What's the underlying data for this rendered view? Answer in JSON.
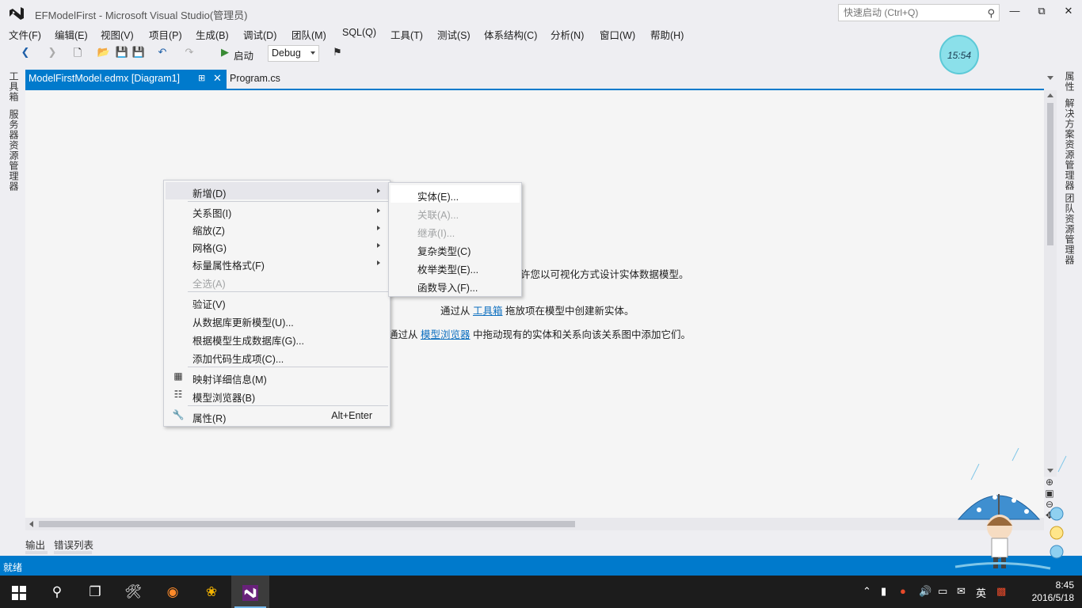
{
  "window": {
    "title": "EFModelFirst - Microsoft Visual Studio(管理员)",
    "quick_launch_placeholder": "快速启动 (Ctrl+Q)"
  },
  "menubar": [
    "文件(F)",
    "编辑(E)",
    "视图(V)",
    "项目(P)",
    "生成(B)",
    "调试(D)",
    "团队(M)",
    "SQL(Q)",
    "工具(T)",
    "测试(S)",
    "体系结构(C)",
    "分析(N)",
    "窗口(W)",
    "帮助(H)"
  ],
  "toolbar": {
    "start_label": "启动",
    "configuration": "Debug",
    "timer": "15:54"
  },
  "left_strip": [
    "工具箱",
    "服务器资源管理器"
  ],
  "right_strip": [
    "属性",
    "解决方案资源管理器",
    "团队资源管理器"
  ],
  "doc_tabs": {
    "active": "ModelFirstModel.edmx [Diagram1]",
    "inactive": "Program.cs"
  },
  "designer": {
    "hint1_tail": "许您以可视化方式设计实体数据模型。",
    "hint2_prefix": "通过从",
    "hint2_link": "工具箱",
    "hint2_suffix": "拖放项在模型中创建新实体。",
    "hint3_prefix": "通过从",
    "hint3_link": "模型浏览器",
    "hint3_suffix": "中拖动现有的实体和关系向该关系图中添加它们。"
  },
  "context_menu": {
    "items": [
      {
        "label": "新增(D)",
        "submenu": true
      },
      {
        "label": "关系图(I)",
        "submenu": true
      },
      {
        "label": "缩放(Z)",
        "submenu": true
      },
      {
        "label": "网格(G)",
        "submenu": true
      },
      {
        "label": "标量属性格式(F)",
        "submenu": true
      },
      {
        "label": "全选(A)",
        "disabled": true
      },
      {
        "label": "验证(V)"
      },
      {
        "label": "从数据库更新模型(U)..."
      },
      {
        "label": "根据模型生成数据库(G)..."
      },
      {
        "label": "添加代码生成项(C)..."
      },
      {
        "label": "映射详细信息(M)",
        "icon": "mapping-details-icon"
      },
      {
        "label": "模型浏览器(B)",
        "icon": "model-browser-icon"
      },
      {
        "label": "属性(R)",
        "icon": "wrench-icon",
        "shortcut": "Alt+Enter"
      }
    ]
  },
  "submenu": {
    "items": [
      {
        "label": "实体(E)..."
      },
      {
        "label": "关联(A)...",
        "disabled": true
      },
      {
        "label": "继承(I)...",
        "disabled": true
      },
      {
        "label": "复杂类型(C)"
      },
      {
        "label": "枚举类型(E)..."
      },
      {
        "label": "函数导入(F)..."
      }
    ]
  },
  "bottom_tabs": [
    "输出",
    "错误列表"
  ],
  "status": "就绪",
  "taskbar": {
    "time": "8:45",
    "date": "2016/5/18",
    "ime": "英"
  },
  "colors": {
    "accent": "#007acc",
    "background": "#eeeef2",
    "designer": "#f5f5f5",
    "taskbar": "#1c1c1c"
  }
}
